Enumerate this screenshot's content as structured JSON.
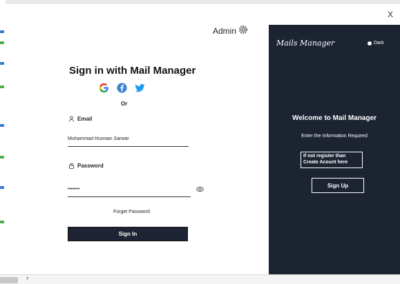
{
  "window": {
    "close_label": "X"
  },
  "header": {
    "admin_label": "Admin"
  },
  "form": {
    "title": "Sign in with Mail Manager",
    "or_label": "Or",
    "email_label": "Email",
    "email_value": "Muhammad Husnain Sarwar",
    "password_label": "Password",
    "password_value": "•••••••",
    "forgot_label": "Forget Password",
    "signin_label": "Sign In",
    "social_icons": [
      "google-icon",
      "facebook-icon",
      "twitter-icon"
    ]
  },
  "panel": {
    "brand": "Mails Manager",
    "dark_label": "Dark",
    "welcome": "Welcome to Mail Manager",
    "enter_info": "Enter the Information Required",
    "register_text": "If not register than Create Acount here",
    "signup_label": "Sign Up"
  },
  "colors": {
    "panel_bg": "#1c2331",
    "button_bg": "#1e2433",
    "google": "#4285f4",
    "facebook": "#3b5998",
    "twitter": "#1da1f2"
  }
}
